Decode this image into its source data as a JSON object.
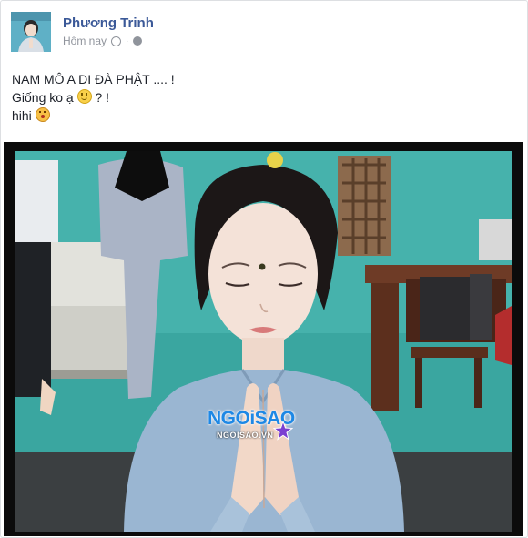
{
  "post": {
    "author": "Phương Trinh",
    "time": "Hôm nay",
    "privacy_icon": "globe-icon",
    "time_icon": "clock-icon",
    "lines": [
      "NAM MÔ A DI ĐÀ PHẬT .... !",
      "Giống ko ạ",
      "? !",
      "hihi"
    ],
    "emojis": [
      "smile-emoji",
      "surprised-emoji"
    ]
  },
  "watermark": {
    "logo": "NGOiSAO",
    "site": "NGOISAO.VN"
  },
  "colors": {
    "author_link": "#3b5998",
    "meta_gray": "#90949c",
    "text": "#1d2129",
    "watermark_blue": "#1e88e5",
    "watermark_purple": "#7b3fd1"
  }
}
